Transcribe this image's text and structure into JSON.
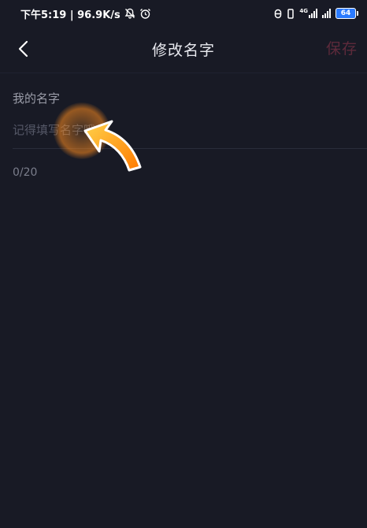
{
  "status_bar": {
    "time_speed": "下午5:19 | 96.9K/s",
    "network_tag": "4G",
    "battery": "64"
  },
  "nav": {
    "title": "修改名字",
    "save_label": "保存"
  },
  "form": {
    "label": "我的名字",
    "input_value": "",
    "input_placeholder": "记得填写名字哦",
    "counter": "0/20"
  }
}
